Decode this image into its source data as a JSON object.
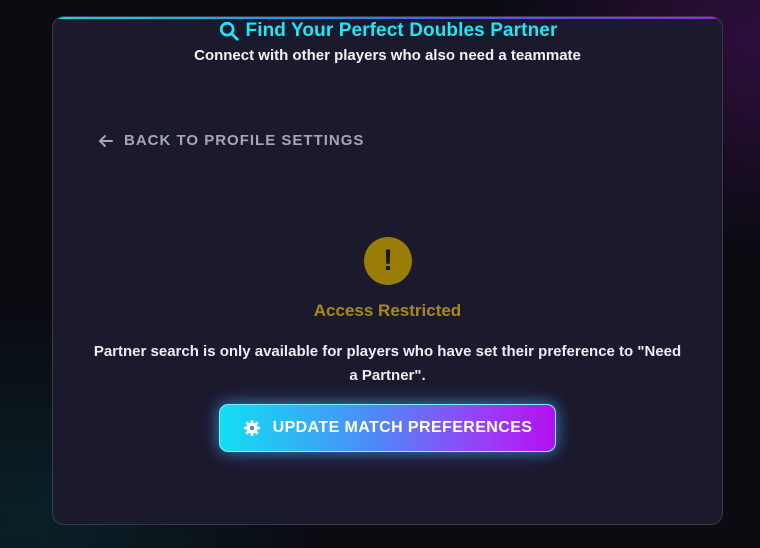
{
  "header": {
    "title": "Find Your Perfect Doubles Partner",
    "title_icon": "search-icon",
    "subtitle": "Connect with other players who also need a teammate"
  },
  "back_link": {
    "label": "BACK TO PROFILE SETTINGS",
    "icon": "arrow-left-icon"
  },
  "notice": {
    "icon": "exclamation-icon",
    "icon_glyph": "!",
    "heading": "Access Restricted",
    "message": "Partner search is only available for players who have set their preference to \"Need a Partner\".",
    "heading_color": "#a88a12"
  },
  "action": {
    "label": "UPDATE MATCH PREFERENCES",
    "icon": "gear-icon"
  },
  "colors": {
    "accent_cyan": "#1ee7f5",
    "accent_purple": "#b40ff0",
    "warning": "#9a7d08",
    "card_bg": "#1b1a2c"
  }
}
